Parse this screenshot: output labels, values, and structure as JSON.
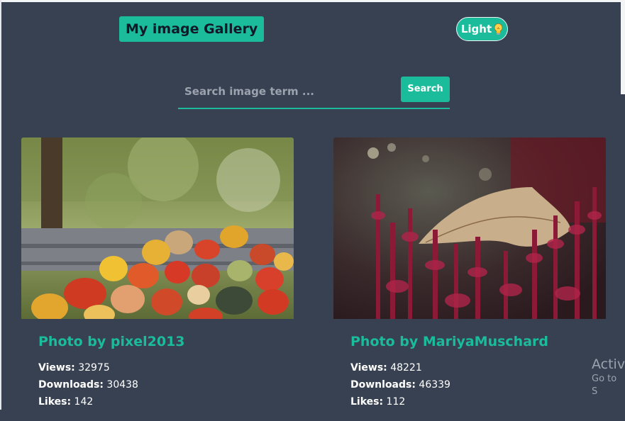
{
  "header": {
    "title": "My image Gallery",
    "theme_toggle_label": "Light"
  },
  "search": {
    "placeholder": "Search image term ...",
    "value": "",
    "button_label": "Search"
  },
  "cards": [
    {
      "author": "Photo by pixel2013",
      "views_label": "Views:",
      "views": "32975",
      "downloads_label": "Downloads:",
      "downloads": "30438",
      "likes_label": "Likes:",
      "likes": "142",
      "image_icon": "pumpkins-photo"
    },
    {
      "author": "Photo by MariyaMuschard",
      "views_label": "Views:",
      "views": "48221",
      "downloads_label": "Downloads:",
      "downloads": "46339",
      "likes_label": "Likes:",
      "likes": "112",
      "image_icon": "autumn-leaf-heather-photo"
    }
  ],
  "watermark": {
    "line1": "Activ",
    "line2": "Go to S"
  },
  "colors": {
    "background": "#374151",
    "accent": "#1abc9c",
    "text": "#ffffff"
  }
}
